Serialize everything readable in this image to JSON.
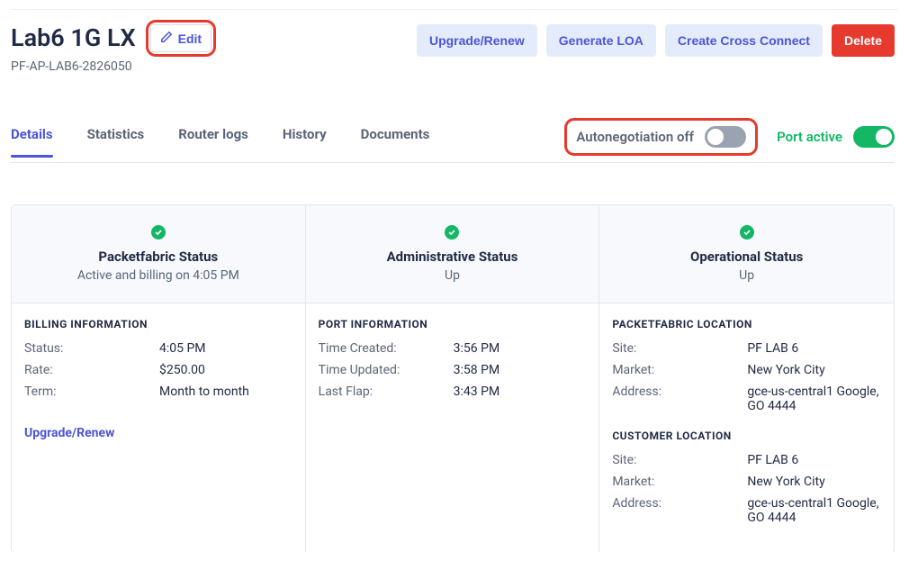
{
  "header": {
    "title": "Lab6 1G LX",
    "edit_label": "Edit",
    "sub_id": "PF-AP-LAB6-2826050",
    "actions": {
      "upgrade": "Upgrade/Renew",
      "loa": "Generate LOA",
      "cross": "Create Cross Connect",
      "delete": "Delete"
    }
  },
  "tabs": {
    "details": "Details",
    "statistics": "Statistics",
    "router": "Router logs",
    "history": "History",
    "documents": "Documents"
  },
  "toggles": {
    "autoneg_label": "Autonegotiation off",
    "port_label": "Port active"
  },
  "status": {
    "pf": {
      "title": "Packetfabric Status",
      "sub": "Active and billing on 4:05 PM"
    },
    "admin": {
      "title": "Administrative Status",
      "sub": "Up"
    },
    "op": {
      "title": "Operational Status",
      "sub": "Up"
    }
  },
  "billing": {
    "section": "BILLING INFORMATION",
    "status_k": "Status:",
    "status_v": "4:05 PM",
    "rate_k": "Rate:",
    "rate_v": "$250.00",
    "term_k": "Term:",
    "term_v": "Month to month",
    "link": "Upgrade/Renew"
  },
  "port": {
    "section": "PORT INFORMATION",
    "created_k": "Time Created:",
    "created_v": "3:56 PM",
    "updated_k": "Time Updated:",
    "updated_v": "3:58 PM",
    "flap_k": "Last Flap:",
    "flap_v": "3:43 PM"
  },
  "loc": {
    "pf_section": "PACKETFABRIC LOCATION",
    "cust_section": "CUSTOMER LOCATION",
    "site_k": "Site:",
    "market_k": "Market:",
    "address_k": "Address:",
    "pf_site": "PF LAB 6",
    "pf_market": "New York City",
    "pf_address": "gce-us-central1 Google, GO 4444",
    "cust_site": "PF LAB 6",
    "cust_market": "New York City",
    "cust_address": "gce-us-central1 Google, GO 4444"
  }
}
